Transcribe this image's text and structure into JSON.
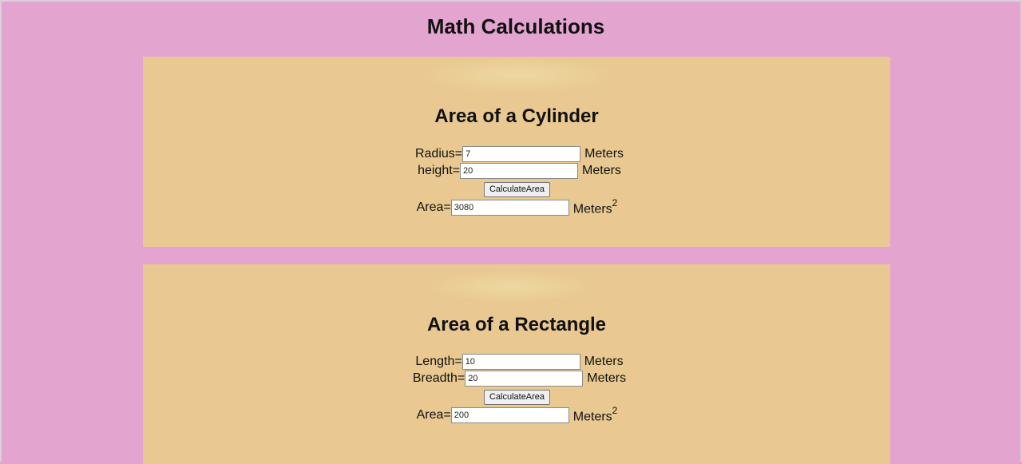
{
  "page": {
    "title": "Math Calculations"
  },
  "cylinder": {
    "heading": "Area of a Cylinder",
    "radius_label": "Radius=",
    "radius_value": "7",
    "radius_unit": "Meters",
    "height_label": "height=",
    "height_value": "20",
    "height_unit": "Meters",
    "button_label": "CalculateArea",
    "area_label": "Area=",
    "area_value": "3080",
    "area_unit": "Meters",
    "area_unit_exp": "2"
  },
  "rectangle": {
    "heading": "Area of a Rectangle",
    "length_label": "Length=",
    "length_value": "10",
    "length_unit": "Meters",
    "breadth_label": "Breadth=",
    "breadth_value": "20",
    "breadth_unit": "Meters",
    "button_label": "CalculateArea",
    "area_label": "Area=",
    "area_value": "200",
    "area_unit": "Meters",
    "area_unit_exp": "2"
  },
  "colors": {
    "page_background": "#e4a4d0",
    "card_background": "#e9c991"
  }
}
